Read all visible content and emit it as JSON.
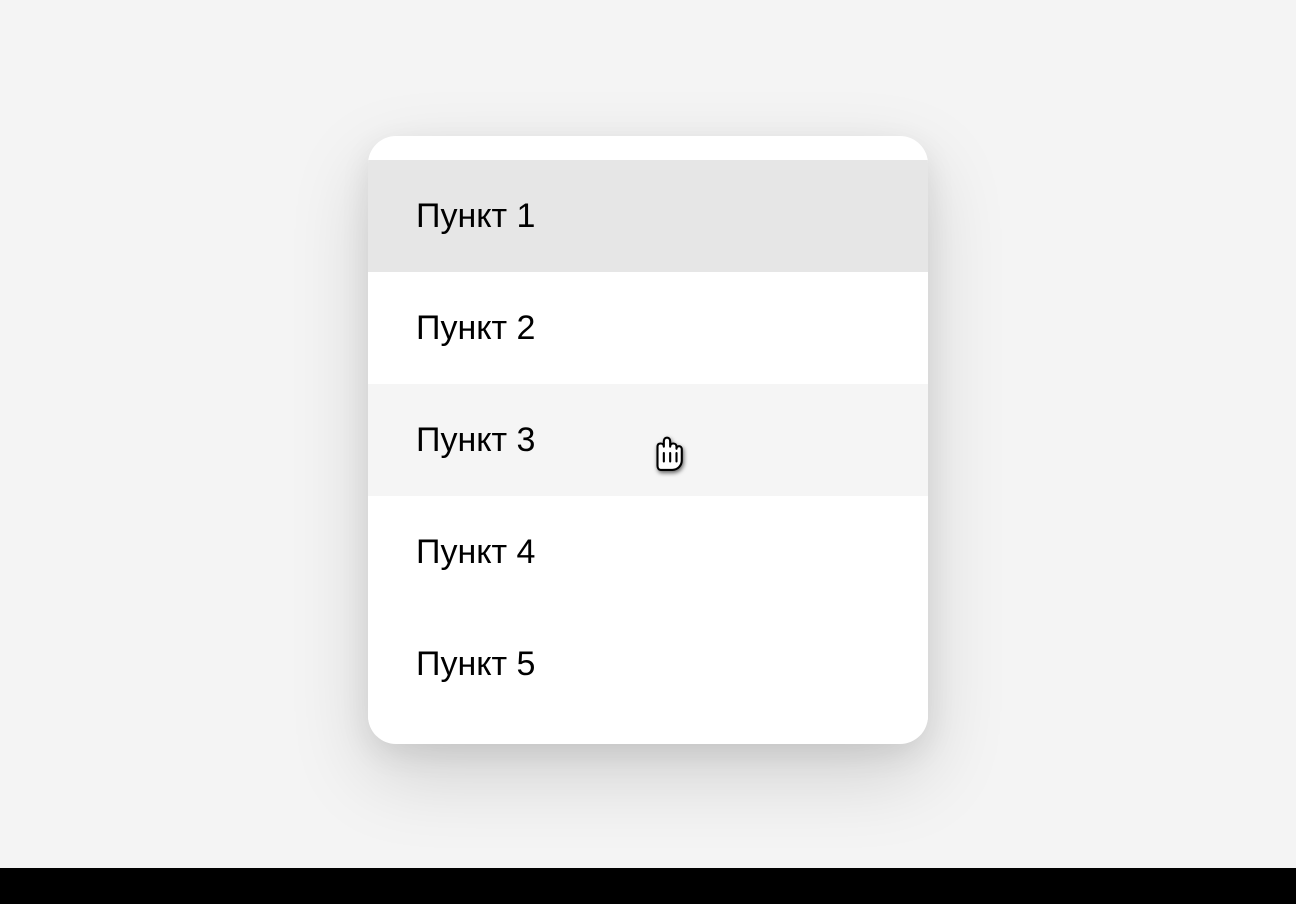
{
  "menu": {
    "items": [
      {
        "label": "Пункт 1",
        "state": "selected"
      },
      {
        "label": "Пункт 2",
        "state": "normal"
      },
      {
        "label": "Пункт 3",
        "state": "hovered"
      },
      {
        "label": "Пункт 4",
        "state": "normal"
      },
      {
        "label": "Пункт 5",
        "state": "normal"
      }
    ]
  }
}
